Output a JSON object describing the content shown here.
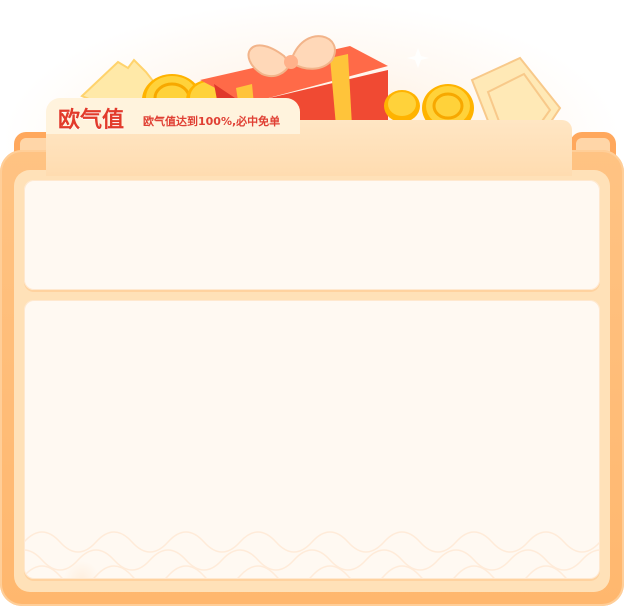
{
  "header": {
    "title": "欧气值",
    "subtitle": "欧气值达到100%,必中免单"
  },
  "panels": {
    "top": {},
    "main": {}
  },
  "colors": {
    "frame": "#ffb76e",
    "frame_border": "#ffa85d",
    "panel_bg": "#fff9f2",
    "title_red": "#e23a2b",
    "gift_red": "#f04a33",
    "coin_gold": "#ffc21a"
  },
  "icons": [
    "gift-box-icon",
    "gold-coin-icon",
    "coupon-ticket-icon",
    "sparkle-icon"
  ]
}
